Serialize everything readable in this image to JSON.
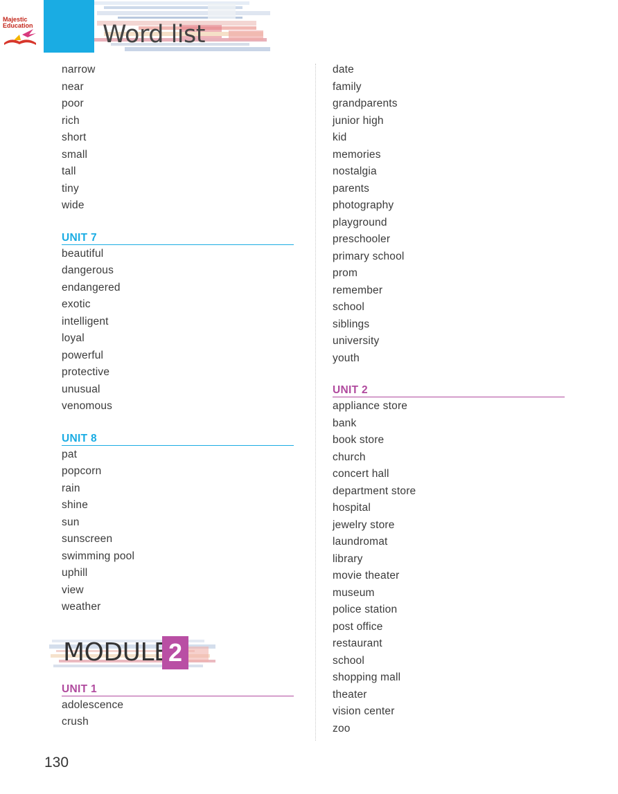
{
  "header": {
    "title": "Word list",
    "logo_line1": "Majestic",
    "logo_line2": "Education"
  },
  "left_column": {
    "continued_words": [
      "narrow",
      "near",
      "poor",
      "rich",
      "short",
      "small",
      "tall",
      "tiny",
      "wide"
    ],
    "unit7": {
      "heading": "UNIT 7",
      "words": [
        "beautiful",
        "dangerous",
        "endangered",
        "exotic",
        "intelligent",
        "loyal",
        "powerful",
        "protective",
        "unusual",
        "venomous"
      ]
    },
    "unit8": {
      "heading": "UNIT 8",
      "words": [
        "pat",
        "popcorn",
        "rain",
        "shine",
        "sun",
        "sunscreen",
        "swimming pool",
        "uphill",
        "view",
        "weather"
      ]
    },
    "module": {
      "label": "MODULE",
      "number": "2"
    },
    "unit1": {
      "heading": "UNIT 1",
      "words": [
        "adolescence",
        "crush"
      ]
    }
  },
  "right_column": {
    "continued_words": [
      "date",
      "family",
      "grandparents",
      "junior high",
      "kid",
      "memories",
      "nostalgia",
      "parents",
      "photography",
      "playground",
      "preschooler",
      "primary school",
      "prom",
      "remember",
      "school",
      "siblings",
      "university",
      "youth"
    ],
    "unit2": {
      "heading": "UNIT 2",
      "words": [
        "appliance store",
        "bank",
        "book store",
        "church",
        "concert hall",
        "department store",
        "hospital",
        "jewelry store",
        "laundromat",
        "library",
        "movie theater",
        "museum",
        "police station",
        "post office",
        "restaurant",
        "school",
        "shopping mall",
        "theater",
        "vision center",
        "zoo"
      ]
    }
  },
  "page_number": "130",
  "colors": {
    "accent_blue": "#1aace3",
    "accent_purple": "#b04a9e"
  }
}
